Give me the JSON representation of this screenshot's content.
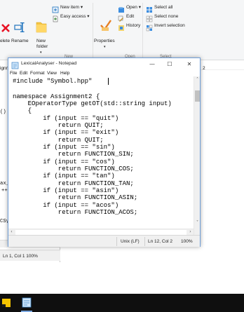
{
  "ribbon": {
    "delete_label": "elete",
    "rename_label": "Rename",
    "new_folder_label": "New",
    "new_folder_label2": "folder",
    "new_item_label": "New item",
    "easy_access_label": "Easy access",
    "properties_label": "Properties",
    "open_label": "Open",
    "edit_label": "Edit",
    "history_label": "History",
    "select_all_label": "Select all",
    "select_none_label": "Select none",
    "invert_selection_label": "Invert selection",
    "group_new": "New",
    "group_open": "Open",
    "group_select": "Select"
  },
  "explorer": {
    "left_fragments": [
      "ignm",
      "()",
      "ax_s",
      "++i",
      "CSyn"
    ],
    "right_fragment": "2"
  },
  "bg_notepad": {
    "status": "Ln 1, Col 1  100%"
  },
  "notepad": {
    "title": "LexicalAnalyser - Notepad",
    "minimize": "—",
    "maximize": "☐",
    "close": "✕",
    "menu": [
      "File",
      "Edit",
      "Format",
      "View",
      "Help"
    ],
    "code_lines": [
      "#include \"Symbol.hpp\"",
      "",
      "namespace Assignment2 {",
      "    EOperatorType getOT(std::string input)",
      "    {",
      "        if (input == \"quit\")",
      "            return QUIT;",
      "        if (input == \"exit\")",
      "            return QUIT;",
      "        if (input == \"sin\")",
      "            return FUNCTION_SIN;",
      "        if (input == \"cos\")",
      "            return FUNCTION_COS;",
      "        if (input == \"tan\")",
      "            return FUNCTION_TAN;",
      "        if (input == \"asin\")",
      "            return FUNCTION_ASIN;",
      "        if (input == \"acos\")",
      "            return FUNCTION_ACOS;"
    ],
    "status": {
      "line_ending": "Unix (LF)",
      "position": "Ln 12, Col 2",
      "zoom": "100%"
    }
  },
  "colors": {
    "accent": "#0078d7",
    "taskbar": "#0f0f0f"
  }
}
